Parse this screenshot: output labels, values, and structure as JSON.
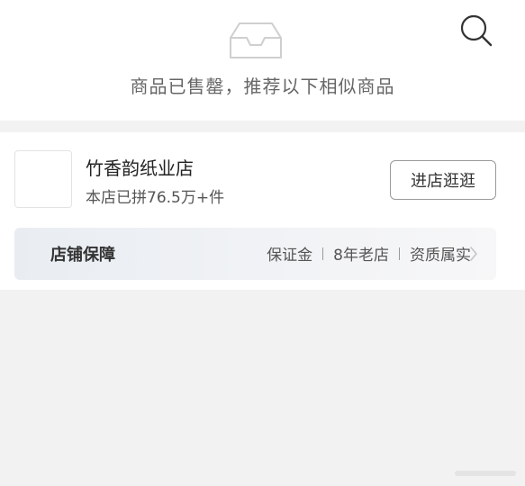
{
  "header": {
    "soldout_message": "商品已售罄，推荐以下相似商品",
    "search_icon": "search-icon",
    "empty_icon": "empty-box-icon"
  },
  "shop": {
    "name": "竹香韵纸业店",
    "sales": "本店已拼76.5万+件",
    "visit_label": "进店逛逛"
  },
  "guarantee": {
    "title": "店铺保障",
    "items": [
      "保证金",
      "8年老店",
      "资质属实"
    ],
    "chevron_icon": "chevron-right-icon"
  },
  "colors": {
    "background": "#f2f2f2",
    "card": "#ffffff",
    "text_primary": "#222222",
    "text_secondary": "#666666"
  }
}
